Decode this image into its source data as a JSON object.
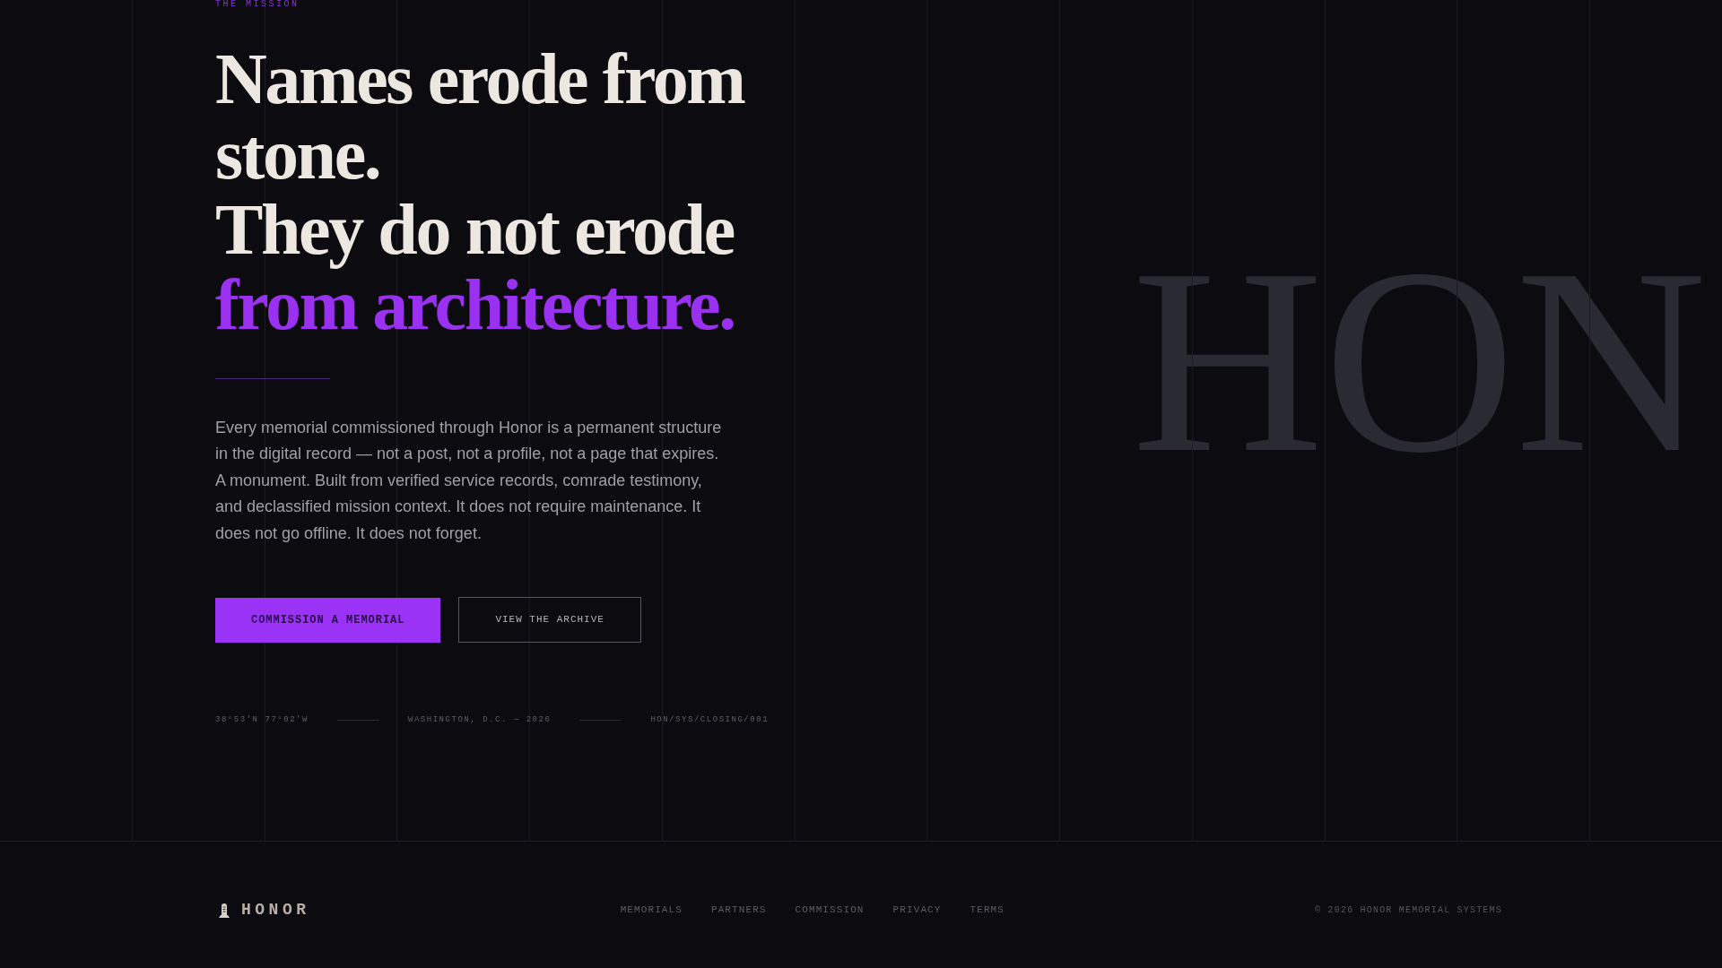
{
  "hero": {
    "eyebrow": "THE MISSION",
    "background_text": "HON",
    "headline": [
      {
        "text": "Names erode from stone.",
        "accent": false
      },
      {
        "text": "They do not erode",
        "accent": false
      },
      {
        "text": "from architecture.",
        "accent": true
      }
    ],
    "paragraph": "Every memorial commissioned through Honor is a permanent structure in the digital record — not a post, not a profile, not a page that expires. A monument. Built from verified service records, comrade testimony, and declassified mission context. It does not require maintenance. It does not go offline. It does not forget.",
    "buttons": [
      {
        "label": "COMMISSION A MEMORIAL",
        "kind": "primary"
      },
      {
        "label": "VIEW THE ARCHIVE",
        "kind": "outline"
      }
    ],
    "meta": [
      "38°53'N 77°02'W",
      "WASHINGTON, D.C. — 2026",
      "HON/SYS/CLOSING/001"
    ]
  },
  "footer": {
    "brand": "HONOR",
    "links": [
      "MEMORIALS",
      "PARTNERS",
      "COMMISSION",
      "PRIVACY",
      "TERMS"
    ],
    "copyright": "© 2026 HONOR MEMORIAL SYSTEMS"
  }
}
